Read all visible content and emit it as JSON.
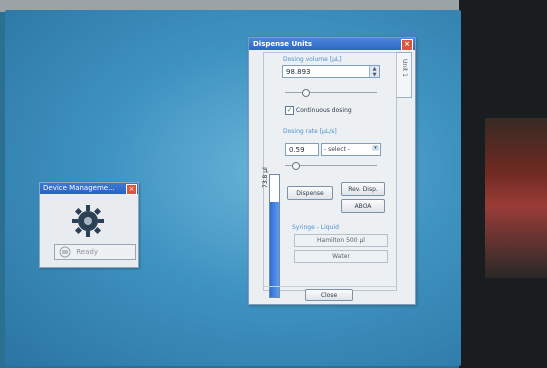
{
  "small_window": {
    "title": "Device Manageme...",
    "status_text": "Ready"
  },
  "main_window": {
    "title": "Dispense Units",
    "tab_label": "Unit 1",
    "dosing_volume_label": "Dosing volume [µL]",
    "dosing_volume_value": "98.893",
    "continuous_dosing_label": "Continuous dosing",
    "continuous_dosing_checked": true,
    "dosing_rate_label": "Dosing rate [µL/s]",
    "dosing_rate_value": "0.59",
    "dosing_rate_select": "- select -",
    "bar_label": "73.8 µl",
    "bar_fill_fraction": 0.78,
    "dispense_button": "Dispense",
    "rev_disp_button": "Rev. Disp.",
    "abort_button": "ABOA",
    "syringe_label": "Syringe - Liquid",
    "syringe_value": "Hamilton 500 µl",
    "liquid_value": "Water",
    "close_button": "Close"
  }
}
